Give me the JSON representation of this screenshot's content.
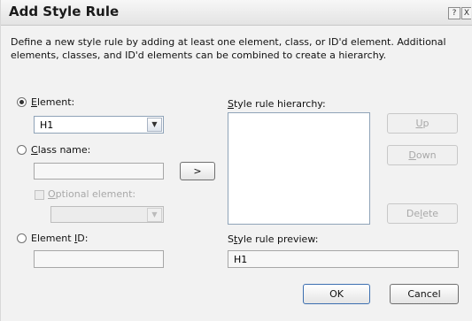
{
  "window": {
    "title": "Add Style Rule",
    "help_glyph": "?",
    "close_glyph": "X"
  },
  "description": "Define a new style rule by adding at least one element, class, or ID'd element.  Additional elements, classes, and ID'd elements can be combined to create a hierarchy.",
  "element": {
    "label_mnemonic": "E",
    "label_rest": "lement:",
    "value": "H1",
    "selected": true
  },
  "class_name": {
    "label_mnemonic": "C",
    "label_rest": "lass name:",
    "value": ""
  },
  "optional_element": {
    "label_mnemonic": "O",
    "label_rest": "ptional element:",
    "value": ""
  },
  "element_id": {
    "label_prefix": "Element ",
    "label_mnemonic": "I",
    "label_rest": "D:",
    "value": ""
  },
  "add_button": ">",
  "hierarchy": {
    "label_mnemonic": "S",
    "label_rest": "tyle rule hierarchy:",
    "items": []
  },
  "up_button": {
    "mnemonic": "U",
    "rest": "p"
  },
  "down_button": {
    "mnemonic": "D",
    "rest": "own"
  },
  "delete_button": {
    "prefix": "De",
    "mnemonic": "l",
    "rest": "ete"
  },
  "preview": {
    "label_prefix": "S",
    "label_mnemonic": "t",
    "label_rest": "yle rule preview:",
    "value": "H1"
  },
  "ok_button": "OK",
  "cancel_button": "Cancel",
  "dropdown_glyph": "▼"
}
